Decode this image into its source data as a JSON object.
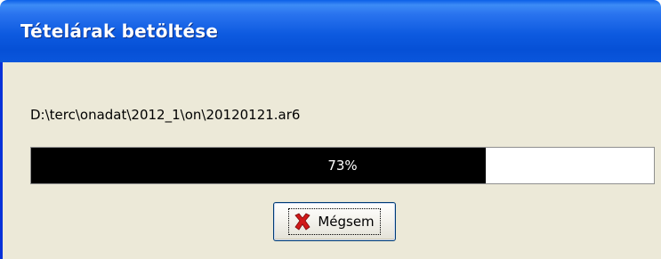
{
  "window": {
    "title": "Tételárak betöltése"
  },
  "file": {
    "path": "D:\\terc\\onadat\\2012_1\\on\\20120121.ar6"
  },
  "progress": {
    "value_percent": 73,
    "label": "73%"
  },
  "buttons": {
    "cancel_label": "Mégsem",
    "cancel_icon": "cancel-x-icon"
  },
  "colors": {
    "progress_fill": "#000000",
    "progress_track": "#ffffff",
    "cancel_icon": "#d11a1a"
  }
}
